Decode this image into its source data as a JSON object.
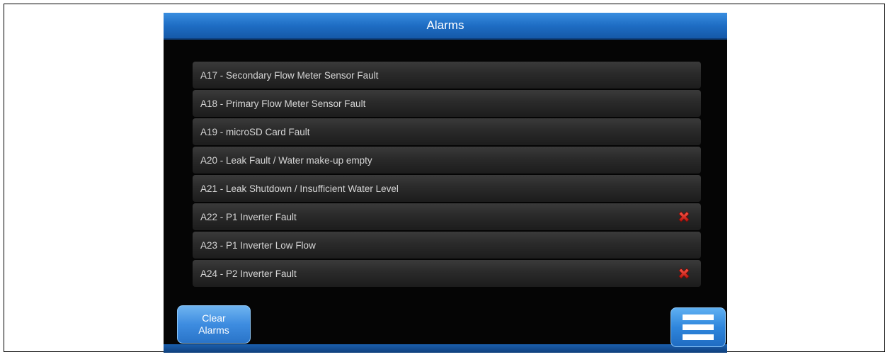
{
  "header": {
    "title": "Alarms"
  },
  "alarms": [
    {
      "label": "A17 - Secondary Flow Meter Sensor Fault",
      "active": false
    },
    {
      "label": "A18 - Primary Flow Meter Sensor Fault",
      "active": false
    },
    {
      "label": "A19 - microSD Card Fault",
      "active": false
    },
    {
      "label": "A20 - Leak Fault / Water make-up empty",
      "active": false
    },
    {
      "label": "A21 - Leak Shutdown / Insufficient Water Level",
      "active": false
    },
    {
      "label": "A22 - P1 Inverter Fault",
      "active": true
    },
    {
      "label": "A23 - P1 Inverter Low Flow",
      "active": false
    },
    {
      "label": "A24 - P2 Inverter Fault",
      "active": true
    }
  ],
  "buttons": {
    "clear_line1": "Clear",
    "clear_line2": "Alarms",
    "menu_icon": "hamburger-menu-icon"
  },
  "colors": {
    "title_bar": "#1e6dc4",
    "alarm_active_icon": "#e0201a",
    "background": "#050505"
  }
}
